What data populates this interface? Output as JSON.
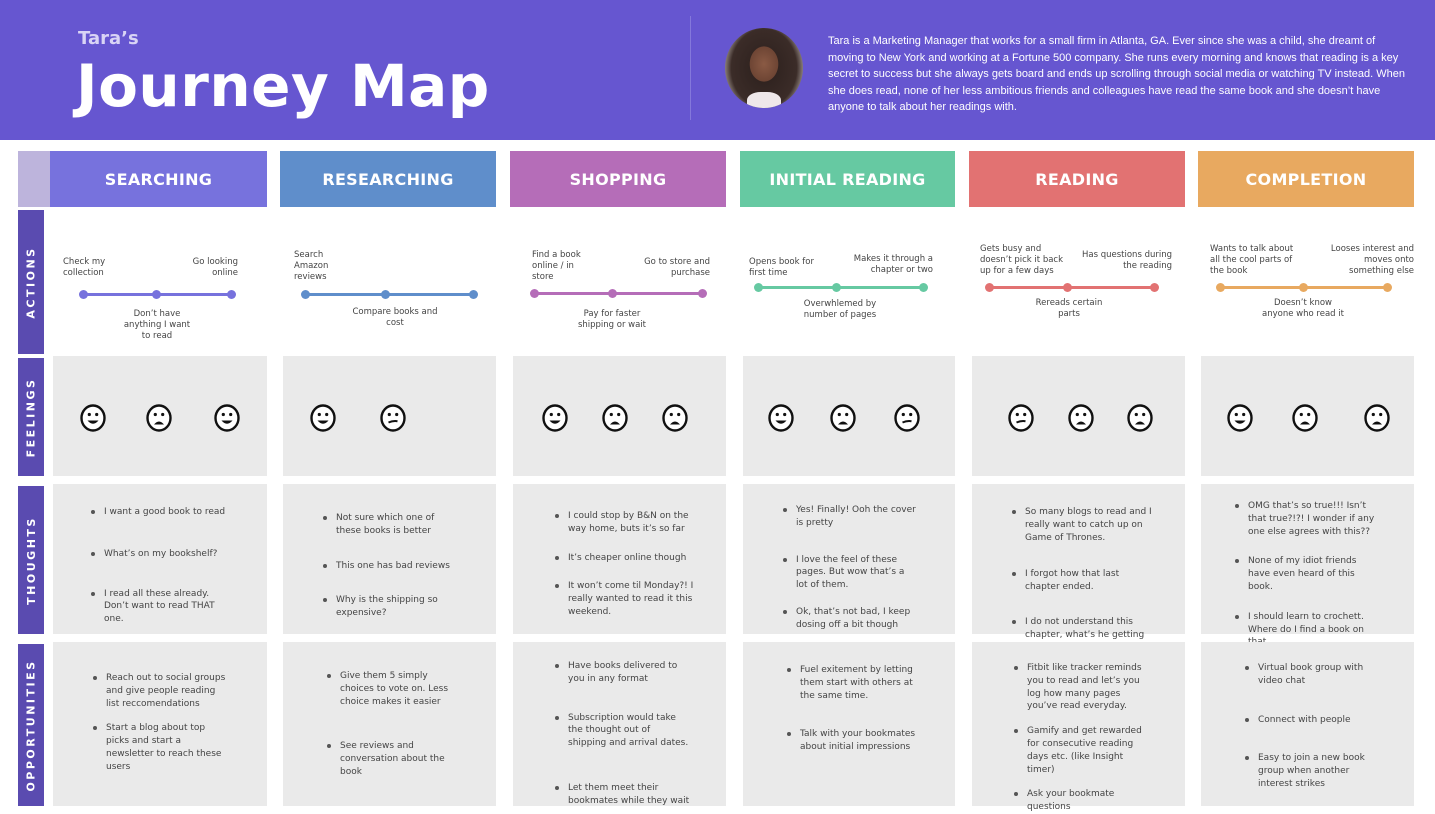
{
  "header": {
    "subtitle": "Tara’s",
    "title": "Journey Map",
    "avatar_alt": "Tara portrait",
    "bio": "Tara is a Marketing Manager that works for a small firm in Atlanta, GA. Ever since she was a child, she dreamt of moving to New York and working at a Fortune 500 company. She runs every morning and knows that reading is a key secret to success but she always gets board and ends up scrolling through social media or watching TV instead. When she does read, none of her less ambitious friends and colleagues have read the same book and she doesn’t have anyone to talk about her readings with."
  },
  "row_labels": [
    "ACTIONS",
    "FEELINGS",
    "THOUGHTS",
    "OPPORTUNITIES"
  ],
  "colors": {
    "header_bg": "#6656d0",
    "row_label_bg": "#5a4bb0",
    "corner": "#bdb4dc",
    "cell_bg": "#eaeaea"
  },
  "stages": [
    {
      "name": "SEARCHING",
      "color": "#7772dd",
      "actions": [
        "Check my collection",
        "Don’t have anything I want to read",
        "Go looking online"
      ],
      "feelings": [
        "happy",
        "sad",
        "happy"
      ],
      "thoughts": [
        "I want a good book to read",
        "What’s on my bookshelf?",
        "I read all these already. Don’t want to read THAT one."
      ],
      "opportunities": [
        "Reach out to social groups and give people reading list reccomendations",
        "Start a blog about top picks and start a newsletter to reach these users"
      ]
    },
    {
      "name": "RESEARCHING",
      "color": "#5f8ecb",
      "actions": [
        "Search Amazon reviews",
        "Compare books and cost",
        ""
      ],
      "feelings": [
        "happy",
        "neutral"
      ],
      "thoughts": [
        "Not sure which one of these books is better",
        "This one has bad reviews",
        "Why is the shipping so expensive?"
      ],
      "opportunities": [
        "Give them 5 simply choices to vote on. Less choice makes it easier",
        "See reviews and conversation about the book"
      ]
    },
    {
      "name": "SHOPPING",
      "color": "#b56db8",
      "actions": [
        "Find a book online / in store",
        "Pay for faster shipping or wait",
        "Go to store and purchase"
      ],
      "feelings": [
        "happy",
        "sad",
        "sad"
      ],
      "thoughts": [
        "I could stop by B&N on the way home, buts it’s so far",
        "It’s cheaper online though",
        "It won’t come til Monday?! I really wanted to read it this weekend."
      ],
      "opportunities": [
        "Have books delivered to you in any format",
        "Subscription would take the thought out of shipping and arrival dates.",
        "Let them meet their bookmates while they wait"
      ]
    },
    {
      "name": "INITIAL READING",
      "color": "#66c9a2",
      "actions": [
        "Opens book for first time",
        "Overwhlemed by number of pages",
        "Makes it through a chapter or two"
      ],
      "feelings": [
        "happy",
        "sad",
        "neutral"
      ],
      "thoughts": [
        "Yes! Finally! Ooh the cover is pretty",
        "I love the feel of these pages. But wow that’s a lot of them.",
        "Ok, that’s not bad, I keep dosing off a bit though"
      ],
      "opportunities": [
        "Fuel exitement by letting them start with others at the same time.",
        "Talk with your bookmates about initial impressions"
      ]
    },
    {
      "name": "READING",
      "color": "#e27272",
      "actions": [
        "Gets busy and doesn’t pick it back up for a few days",
        "Rereads certain parts",
        "Has questions during the reading"
      ],
      "feelings": [
        "neutral",
        "sad",
        "sad"
      ],
      "thoughts": [
        "So many blogs to read and I really want to catch up on Game of Thrones.",
        "I forgot how that last chapter ended.",
        "I do not understand this chapter, what’s he getting at?"
      ],
      "opportunities": [
        "Fitbit like tracker reminds you to read and let’s you log how many pages you’ve read everyday.",
        "Gamify and get rewarded for consecutive reading days etc. (like Insight timer)",
        "Ask your bookmate questions"
      ]
    },
    {
      "name": "COMPLETION",
      "color": "#e8a960",
      "actions": [
        "Wants to talk about all the cool parts of the book",
        "Doesn’t know anyone who read it",
        "Looses interest and moves onto something else"
      ],
      "feelings": [
        "happy",
        "sad",
        "sad"
      ],
      "thoughts": [
        "OMG that’s so true!!! Isn’t that true?!?! I wonder if any one else agrees with this??",
        "None of my idiot friends have even heard of this book.",
        "I should learn to crochett. Where do I find a book on that..."
      ],
      "opportunities": [
        "Virtual book group with video chat",
        "Connect with people",
        "Easy to join a new book group when another interest strikes"
      ]
    }
  ]
}
